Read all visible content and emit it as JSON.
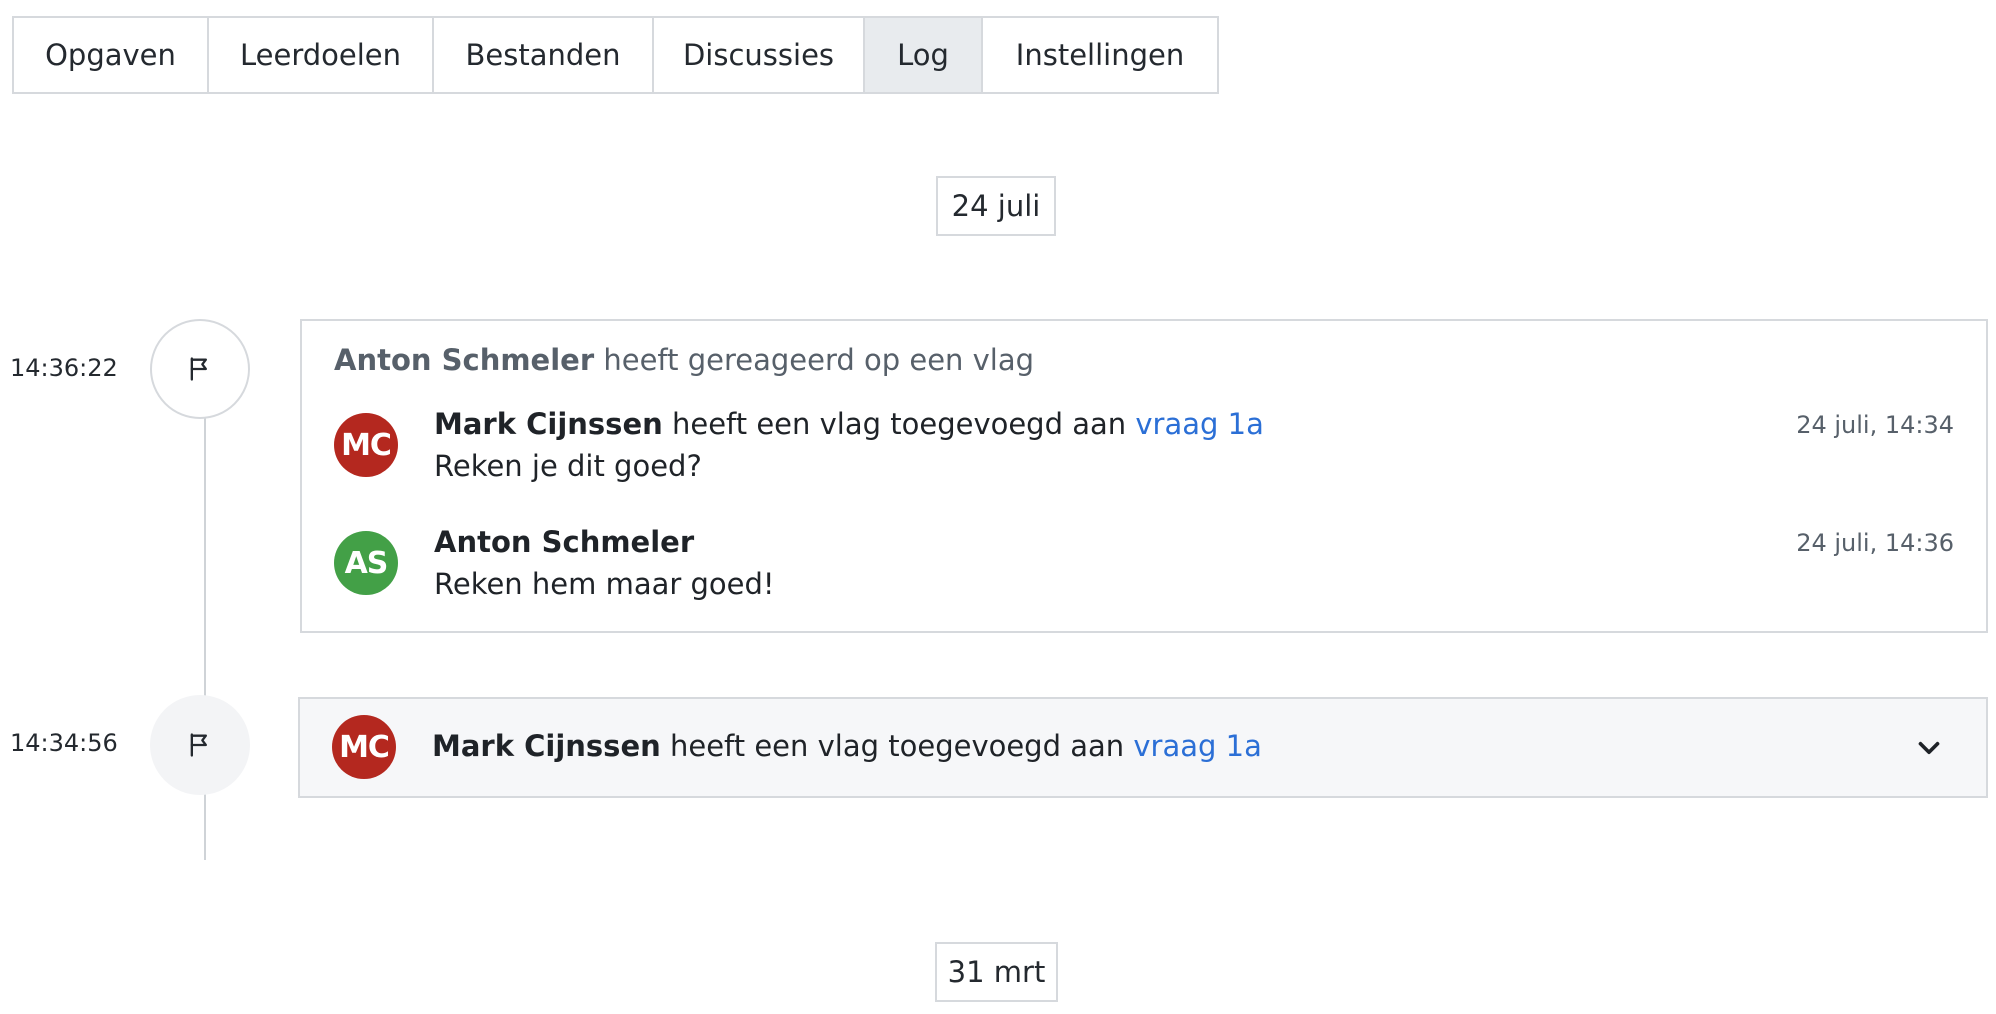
{
  "tabs": [
    {
      "label": "Opgaven",
      "active": false
    },
    {
      "label": "Leerdoelen",
      "active": false
    },
    {
      "label": "Bestanden",
      "active": false
    },
    {
      "label": "Discussies",
      "active": false
    },
    {
      "label": "Log",
      "active": true
    },
    {
      "label": "Instellingen",
      "active": false
    }
  ],
  "dates": {
    "first": "24 juli",
    "second": "31 mrt"
  },
  "events": [
    {
      "time": "14:36:22",
      "icon": "flag-icon",
      "header": {
        "actor": "Anton Schmeler",
        "action": "heeft gereageerd op een vlag"
      },
      "messages": [
        {
          "initials": "MC",
          "avatar_color": "#b4281f",
          "author": "Mark Cijnssen",
          "action": "heeft een vlag toegevoegd aan",
          "link": "vraag 1a",
          "body": "Reken je dit goed?",
          "timestamp": "24 juli, 14:34"
        },
        {
          "initials": "AS",
          "avatar_color": "#43a047",
          "author": "Anton Schmeler",
          "action": "",
          "link": "",
          "body": "Reken hem maar goed!",
          "timestamp": "24 juli, 14:36"
        }
      ]
    },
    {
      "time": "14:34:56",
      "icon": "flag-icon",
      "collapsed": true,
      "message": {
        "initials": "MC",
        "avatar_color": "#b4281f",
        "author": "Mark Cijnssen",
        "action": "heeft een vlag toegevoegd aan",
        "link": "vraag 1a"
      },
      "expand_icon": "chevron-down-icon"
    }
  ],
  "colors": {
    "accent_link": "#2b6fd6",
    "active_tab_bg": "#e8ebee",
    "border": "#d6d9dd"
  }
}
